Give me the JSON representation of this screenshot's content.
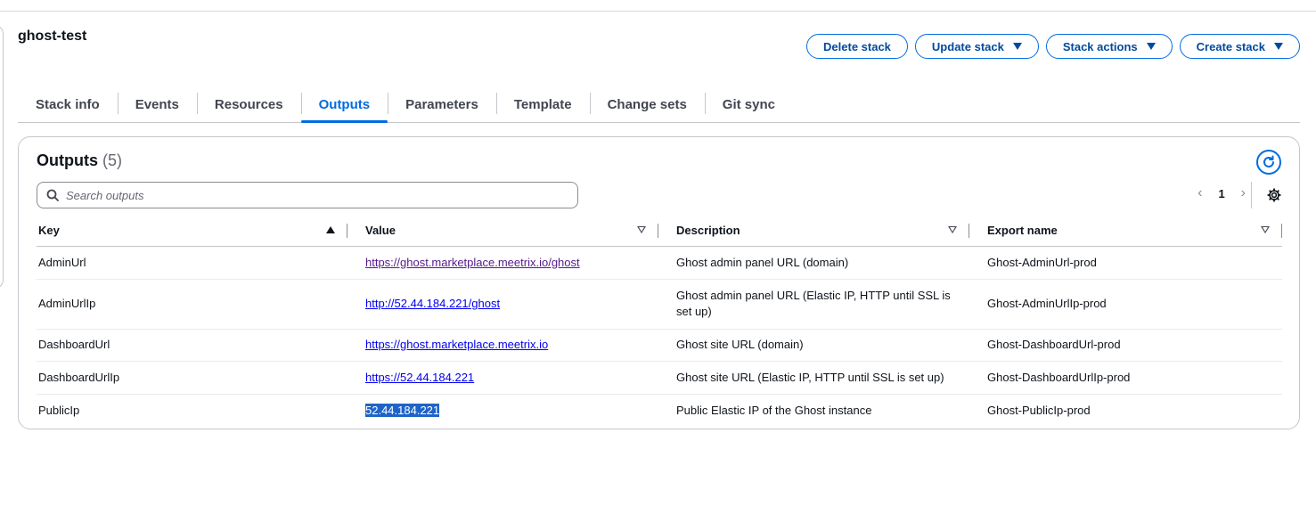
{
  "stack": {
    "name": "ghost-test",
    "actions": [
      {
        "label": "Delete stack",
        "dropdown": false
      },
      {
        "label": "Update stack",
        "dropdown": true
      },
      {
        "label": "Stack actions",
        "dropdown": true
      },
      {
        "label": "Create stack",
        "dropdown": true
      }
    ]
  },
  "tabs": [
    {
      "label": "Stack info",
      "active": false
    },
    {
      "label": "Events",
      "active": false
    },
    {
      "label": "Resources",
      "active": false
    },
    {
      "label": "Outputs",
      "active": true
    },
    {
      "label": "Parameters",
      "active": false
    },
    {
      "label": "Template",
      "active": false
    },
    {
      "label": "Change sets",
      "active": false
    },
    {
      "label": "Git sync",
      "active": false
    }
  ],
  "outputs": {
    "title": "Outputs",
    "count": "(5)",
    "search_placeholder": "Search outputs",
    "page": "1",
    "columns": {
      "key": "Key",
      "value": "Value",
      "description": "Description",
      "export": "Export name"
    },
    "rows": [
      {
        "key": "AdminUrl",
        "value": "https://ghost.marketplace.meetrix.io/ghost",
        "value_style": "visited",
        "description": "Ghost admin panel URL (domain)",
        "export": "Ghost-AdminUrl-prod"
      },
      {
        "key": "AdminUrlIp",
        "value": "http://52.44.184.221/ghost",
        "value_style": "link",
        "description": "Ghost admin panel URL (Elastic IP, HTTP until SSL is set up)",
        "export": "Ghost-AdminUrlIp-prod"
      },
      {
        "key": "DashboardUrl",
        "value": "https://ghost.marketplace.meetrix.io",
        "value_style": "link",
        "description": "Ghost site URL (domain)",
        "export": "Ghost-DashboardUrl-prod"
      },
      {
        "key": "DashboardUrlIp",
        "value": "https://52.44.184.221",
        "value_style": "link",
        "description": "Ghost site URL (Elastic IP, HTTP until SSL is set up)",
        "export": "Ghost-DashboardUrlIp-prod"
      },
      {
        "key": "PublicIp",
        "value": "52.44.184.221",
        "value_style": "selected",
        "description": "Public Elastic IP of the Ghost instance",
        "export": "Ghost-PublicIp-prod"
      }
    ]
  },
  "colors": {
    "accent": "#006ce0",
    "link": "#0000ee",
    "visited": "#551a8b",
    "selection": "#1e64c8"
  },
  "icons": [
    "caret-down-icon",
    "search-icon",
    "refresh-icon",
    "chevron-left-icon",
    "chevron-right-icon",
    "settings-gear-icon",
    "sort-ascending-icon",
    "sort-descending-icon"
  ]
}
